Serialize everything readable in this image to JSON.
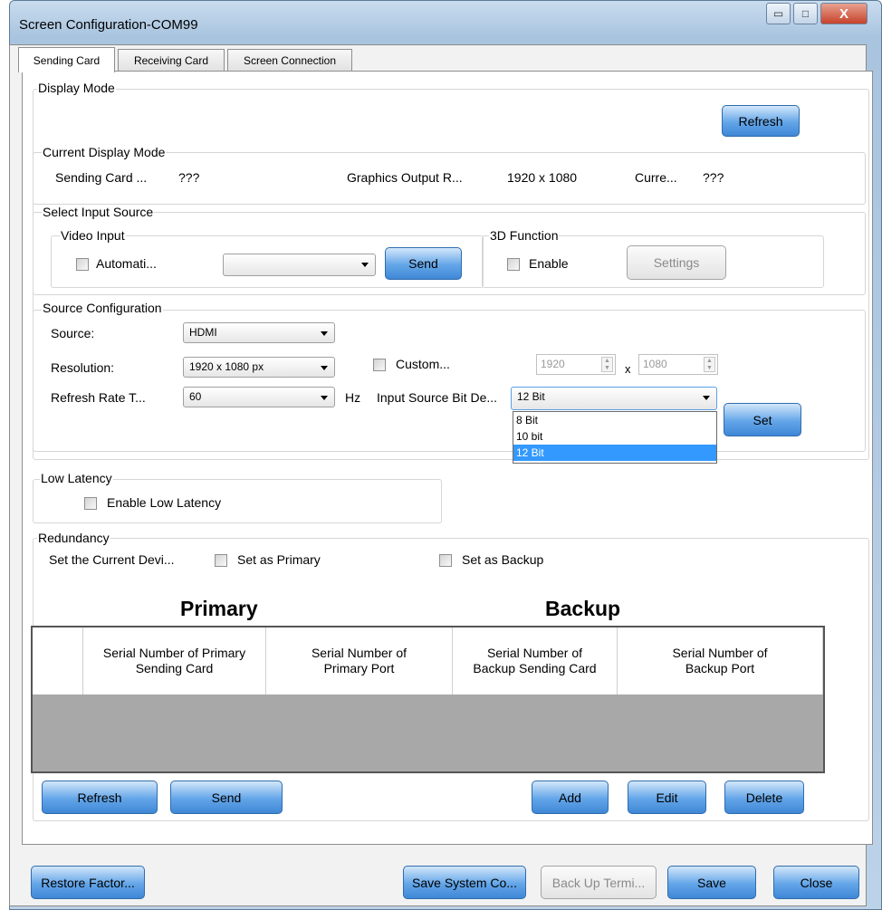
{
  "window": {
    "title": "Screen Configuration-COM99",
    "minimize": "▭",
    "maximize": "□",
    "close": "X"
  },
  "tabs": [
    "Sending Card",
    "Receiving Card",
    "Screen Connection"
  ],
  "display_mode": {
    "legend": "Display Mode",
    "refresh": "Refresh"
  },
  "current_display": {
    "legend": "Current Display Mode",
    "sending_card_label": "Sending Card ...",
    "sending_card_value": "???",
    "graphics_label": "Graphics Output R...",
    "graphics_value": "1920 x 1080",
    "current_label": "Curre...",
    "current_value": "???"
  },
  "input_source": {
    "legend": "Select Input Source",
    "video_input": "Video Input",
    "automatic": "Automati...",
    "select_value": "",
    "send": "Send",
    "function_3d": "3D Function",
    "enable": "Enable",
    "settings": "Settings"
  },
  "source_config": {
    "legend": "Source Configuration",
    "source_label": "Source:",
    "source_value": "HDMI",
    "resolution_label": "Resolution:",
    "resolution_value": "1920 x 1080 px",
    "custom": "Custom...",
    "width": "1920",
    "x": "x",
    "height": "1080",
    "refresh_label": "Refresh Rate T...",
    "refresh_value": "60",
    "hz": "Hz",
    "bitdepth_label": "Input Source Bit De...",
    "bitdepth_value": "12 Bit",
    "bitdepth_options": [
      "8 Bit",
      "10 bit",
      "12 Bit"
    ],
    "set": "Set"
  },
  "low_latency": {
    "legend": "Low Latency",
    "enable": "Enable Low Latency"
  },
  "redundancy": {
    "legend": "Redundancy",
    "set_current": "Set the Current Devi...",
    "set_primary": "Set as Primary",
    "set_backup": "Set as Backup",
    "primary": "Primary",
    "backup": "Backup",
    "columns": [
      "Serial Number of Primary Sending Card",
      "Serial Number of Primary Port",
      "Serial Number of Backup Sending Card",
      "Serial Number of Backup Port"
    ],
    "refresh": "Refresh",
    "send": "Send",
    "add": "Add",
    "edit": "Edit",
    "delete": "Delete"
  },
  "footer": {
    "restore": "Restore Factor...",
    "save_system": "Save System Co...",
    "backup": "Back Up Termi...",
    "save": "Save",
    "close": "Close"
  }
}
